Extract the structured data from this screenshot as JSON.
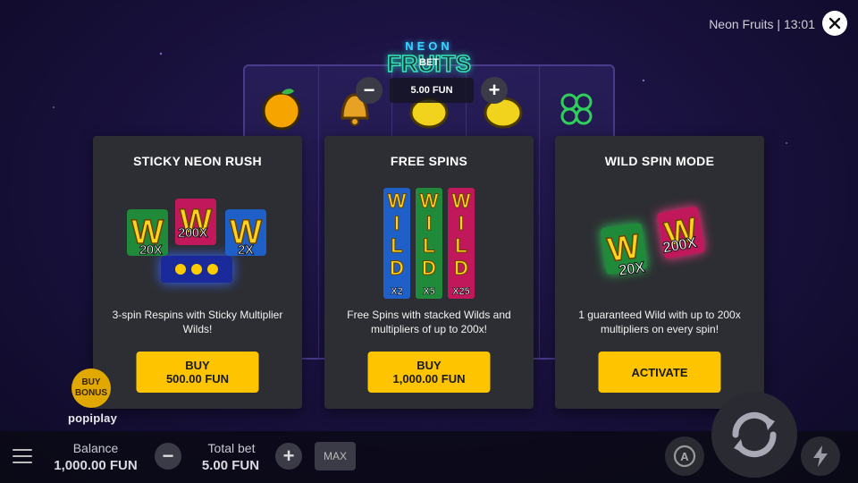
{
  "header": {
    "title_time": "Neon Fruits | 13:01"
  },
  "logo": {
    "line1": "NEON",
    "line2": "FRUITS"
  },
  "bet": {
    "label": "BET",
    "value": "5.00 FUN",
    "minus": "−",
    "plus": "+"
  },
  "cards": [
    {
      "title": "STICKY NEON RUSH",
      "description": "3-spin Respins with Sticky Multiplier Wilds!",
      "button_line1": "BUY",
      "button_line2": "500.00 FUN",
      "tiles": [
        {
          "letter": "W",
          "mult": "20X",
          "color": "#1f8a3a"
        },
        {
          "letter": "W",
          "mult": "200X",
          "color": "#c0185a"
        },
        {
          "letter": "W",
          "mult": "2X",
          "color": "#1f5fc8"
        }
      ]
    },
    {
      "title": "FREE SPINS",
      "description": "Free Spins with stacked Wilds and multipliers of up to 200x!",
      "button_line1": "BUY",
      "button_line2": "1,000.00 FUN",
      "columns": [
        {
          "letters": [
            "W",
            "I",
            "L",
            "D"
          ],
          "mult": "X2",
          "color": "#1f5fc8"
        },
        {
          "letters": [
            "W",
            "I",
            "L",
            "D"
          ],
          "mult": "X5",
          "color": "#1f8a3a"
        },
        {
          "letters": [
            "W",
            "I",
            "L",
            "D"
          ],
          "mult": "X25",
          "color": "#c0185a"
        }
      ]
    },
    {
      "title": "WILD SPIN MODE",
      "description": "1 guaranteed Wild with up to 200x multipliers on every spin!",
      "button_line1": "ACTIVATE",
      "tiles": [
        {
          "letter": "W",
          "mult": "20X",
          "color": "#1f8a3a"
        },
        {
          "letter": "W",
          "mult": "200X",
          "color": "#c0185a"
        }
      ]
    }
  ],
  "bottom": {
    "balance_label": "Balance",
    "balance_value": "1,000.00 FUN",
    "total_bet_label": "Total bet",
    "total_bet_value": "5.00 FUN",
    "max_label": "MAX",
    "minus": "−",
    "plus": "+"
  },
  "buy_bonus": {
    "label": "BUY BONUS"
  },
  "brand": "popiplay",
  "colors": {
    "accent": "#ffc400",
    "card_bg": "#2d2e33"
  }
}
